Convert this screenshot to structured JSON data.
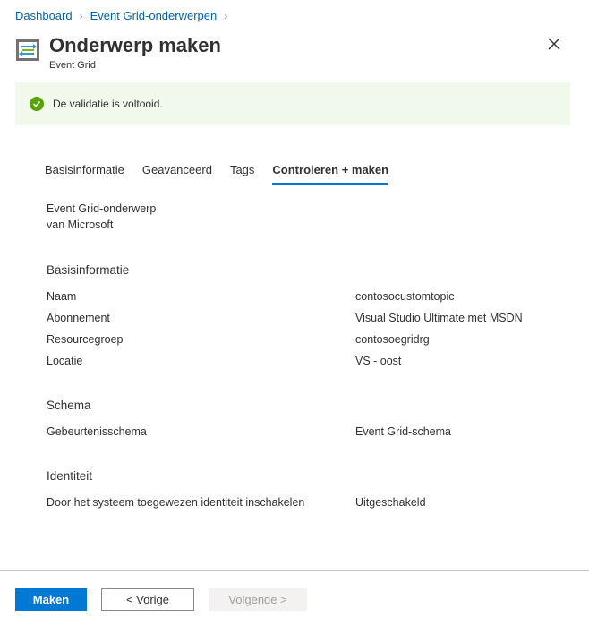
{
  "breadcrumb": {
    "items": [
      "Dashboard",
      "Event Grid-onderwerpen"
    ]
  },
  "header": {
    "title": "Onderwerp maken",
    "subtitle": "Event Grid",
    "icon": "event-grid-icon"
  },
  "banner": {
    "message": "De validatie is voltooid.",
    "status_color": "#57a300"
  },
  "tabs": [
    {
      "label": "Basisinformatie"
    },
    {
      "label": "Geavanceerd"
    },
    {
      "label": "Tags"
    },
    {
      "label": "Controleren + maken",
      "active": true
    }
  ],
  "product": {
    "name": "Event Grid-onderwerp",
    "publisher": "van Microsoft"
  },
  "sections": {
    "basics": {
      "title": "Basisinformatie",
      "rows": [
        {
          "key": "Naam",
          "value": "contosocustomtopic"
        },
        {
          "key": "Abonnement",
          "value": "Visual Studio Ultimate met MSDN"
        },
        {
          "key": "Resourcegroep",
          "value": "contosoegridrg"
        },
        {
          "key": "Locatie",
          "value": "VS - oost"
        }
      ]
    },
    "schema": {
      "title": "Schema",
      "rows": [
        {
          "key": "Gebeurtenisschema",
          "value": "Event Grid-schema"
        }
      ]
    },
    "identity": {
      "title": "Identiteit",
      "rows": [
        {
          "key": "Door het systeem toegewezen identiteit inschakelen",
          "value": "Uitgeschakeld"
        }
      ]
    }
  },
  "footer": {
    "create_label": "Maken",
    "previous_label": "< Vorige",
    "next_label": "Volgende >"
  },
  "colors": {
    "accent": "#0078d4",
    "link": "#0062ad",
    "banner_bg": "#f1f8ec"
  }
}
